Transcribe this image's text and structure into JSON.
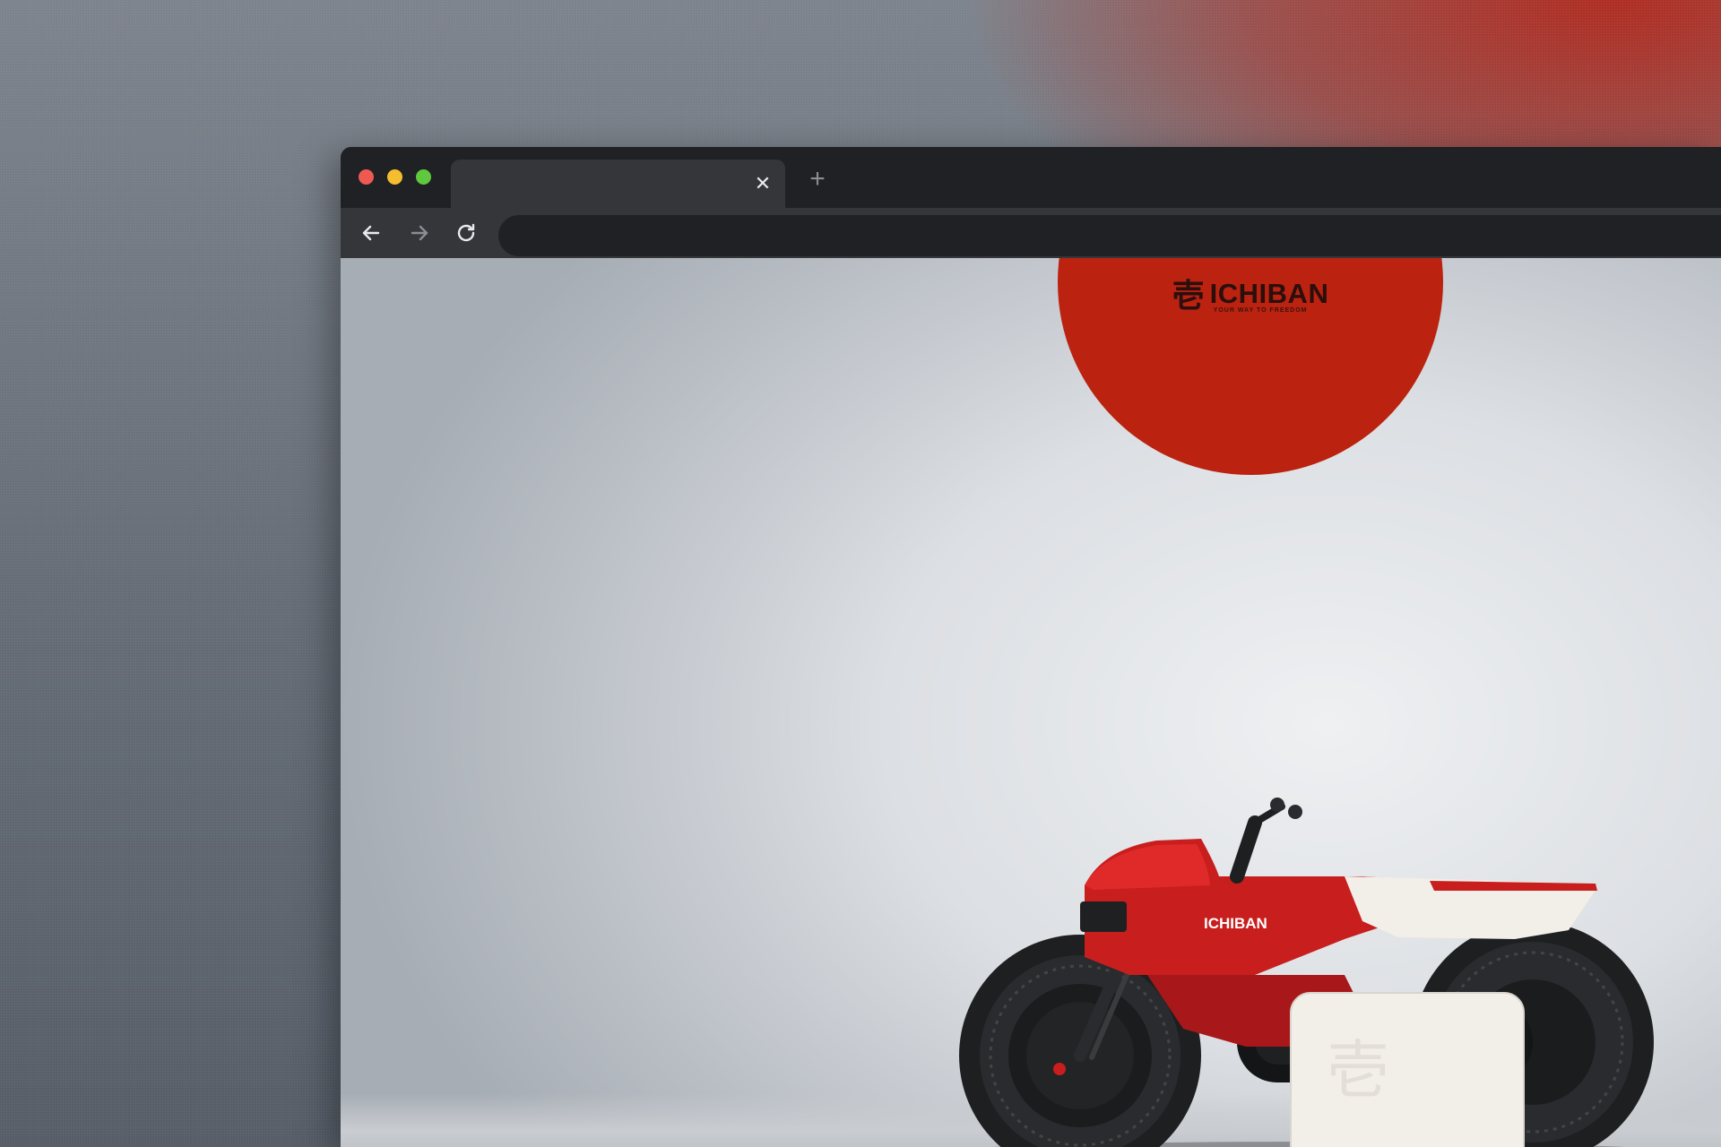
{
  "window": {
    "traffic_lights": {
      "close": "#ee5a52",
      "minimize": "#f5bd2f",
      "zoom": "#5fc83e"
    }
  },
  "tabs": [
    {
      "title": "",
      "active": true,
      "close_icon": "close-icon"
    }
  ],
  "toolbar": {
    "back_icon": "arrow-left-icon",
    "forward_icon": "arrow-right-icon",
    "reload_icon": "reload-icon",
    "address": ""
  },
  "page": {
    "brand": {
      "kanji": "壱",
      "name": "ICHIBAN",
      "tagline": "YOUR WAY TO FREEDOM",
      "badge_color": "#bb220f"
    },
    "hero_bike": {
      "tank_label": "ICHIBAN",
      "colors": {
        "body": "#c81e1e",
        "panel": "#f2efe9",
        "tire": "#1e1f21"
      }
    }
  }
}
